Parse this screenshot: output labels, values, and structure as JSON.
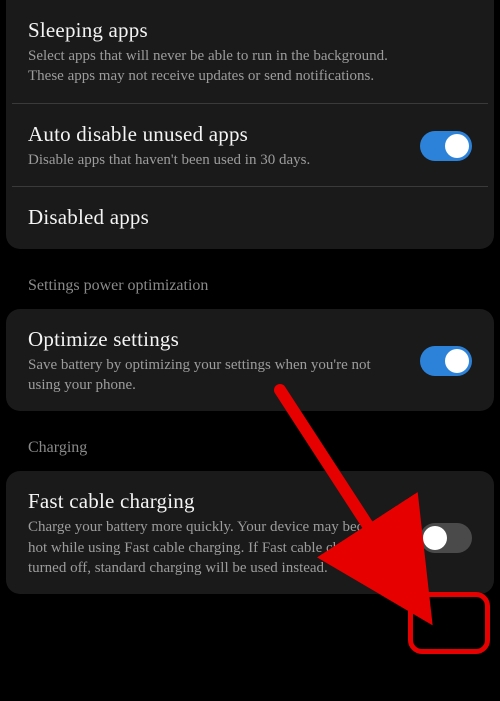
{
  "card1": {
    "sleeping": {
      "title": "Sleeping apps",
      "desc": "Select apps that will never be able to run in the background. These apps may not receive updates or send notifications."
    },
    "autoDisable": {
      "title": "Auto disable unused apps",
      "desc": "Disable apps that haven't been used in 30 days.",
      "toggle": true
    },
    "disabled": {
      "title": "Disabled apps"
    }
  },
  "sectionPower": "Settings power optimization",
  "card2": {
    "optimize": {
      "title": "Optimize settings",
      "desc": "Save battery by optimizing your settings when you're not using your phone.",
      "toggle": true
    }
  },
  "sectionCharging": "Charging",
  "card3": {
    "fast": {
      "title": "Fast cable charging",
      "desc": "Charge your battery more quickly. Your device may become hot while using Fast cable charging. If Fast cable charging is turned off, standard charging will be used instead.",
      "toggle": false
    }
  }
}
